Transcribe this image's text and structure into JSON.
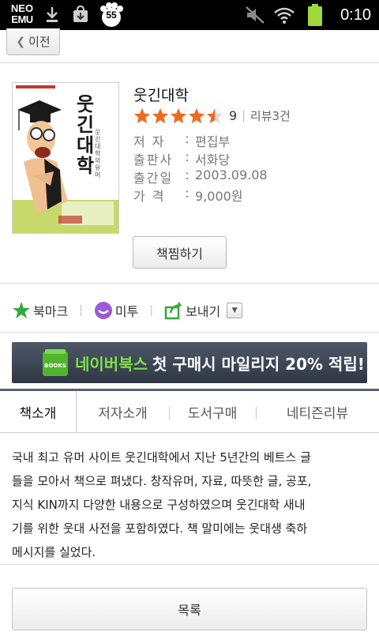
{
  "status_bar": {
    "app_label_line1": "NEO",
    "app_label_line2": "EMU",
    "badge_count": "55",
    "time": "0:10",
    "icons": [
      "download-icon",
      "store-bag-icon",
      "paw-badge-icon",
      "mute-icon",
      "wifi-icon",
      "battery-icon"
    ]
  },
  "nav": {
    "back_label": "이전"
  },
  "book": {
    "title": "웃긴대학",
    "rating_value": "9",
    "review_count": "리뷰3건",
    "star_fill": [
      1,
      1,
      1,
      1,
      0.5
    ],
    "meta": [
      {
        "key": "저 자",
        "value": "편집부"
      },
      {
        "key": "출판사",
        "value": "서화당"
      },
      {
        "key": "출간일",
        "value": "2003.09.08"
      },
      {
        "key": "가 격",
        "value": "9,000원"
      }
    ],
    "wish_button": "책찜하기"
  },
  "cover": {
    "title_chars": [
      "웃",
      "긴",
      "대",
      "학"
    ],
    "subtitle": "웃긴대학의 유머"
  },
  "share": {
    "bookmark": "북마크",
    "metoo": "미투",
    "send": "보내기"
  },
  "banner": {
    "icon_label": "BOOKS",
    "brand": "네이버북스",
    "text": "첫 구매시 마일리지 20% 적립!"
  },
  "tabs": [
    {
      "label": "책소개",
      "active": true
    },
    {
      "label": "저자소개",
      "active": false
    },
    {
      "label": "도서구매",
      "active": false
    },
    {
      "label": "네티즌리뷰",
      "active": false
    }
  ],
  "description": {
    "lines": [
      "국내 최고 유머 사이트 웃긴대학에서 지난 5년간의 베트스 글",
      "들을 모아서 책으로 펴냈다. 창작유머, 자료, 따뜻한 글, 공포,",
      "지식 KIN까지 다양한 내용으로 구성하였으며 웃긴대학 새내",
      "기를 위한 웃대 사전을 포함하였다. 책 말미에는 웃대생 축하",
      "메시지를 실었다."
    ]
  },
  "list_button": "목록",
  "colors": {
    "star": "#f06a1e",
    "banner_bg": "#3b4351",
    "banner_brand": "#7de04a",
    "tab_border": "#5a6070",
    "metoo_purple": "#9b5ad6",
    "bookmark_green": "#37a83a"
  }
}
